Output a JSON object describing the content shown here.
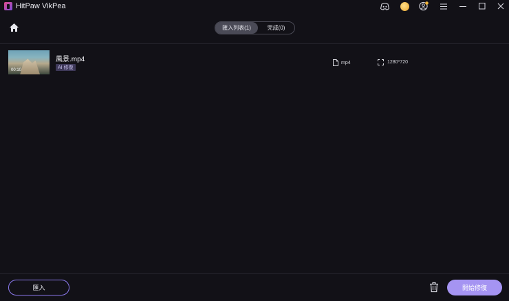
{
  "window": {
    "title": "HitPaw VikPea"
  },
  "titlebar_icons": [
    "discord-icon",
    "coin-icon",
    "account-icon",
    "menu-icon",
    "minimize-icon",
    "maximize-icon",
    "close-icon"
  ],
  "tabs": [
    {
      "label": "匯入列表(1)",
      "active": true
    },
    {
      "label": "完成(0)",
      "active": false
    }
  ],
  "file": {
    "name": "風景.mp4",
    "duration": "00:10",
    "model": "AI 修復",
    "format": "mp4",
    "resolution": "1280*720"
  },
  "footer": {
    "import_label": "匯入",
    "start_label": "開始修復"
  },
  "colors": {
    "background": "#121117",
    "accent": "#a594f2",
    "accent_border": "#8d7bf0",
    "badge_bg": "#3d3858"
  }
}
